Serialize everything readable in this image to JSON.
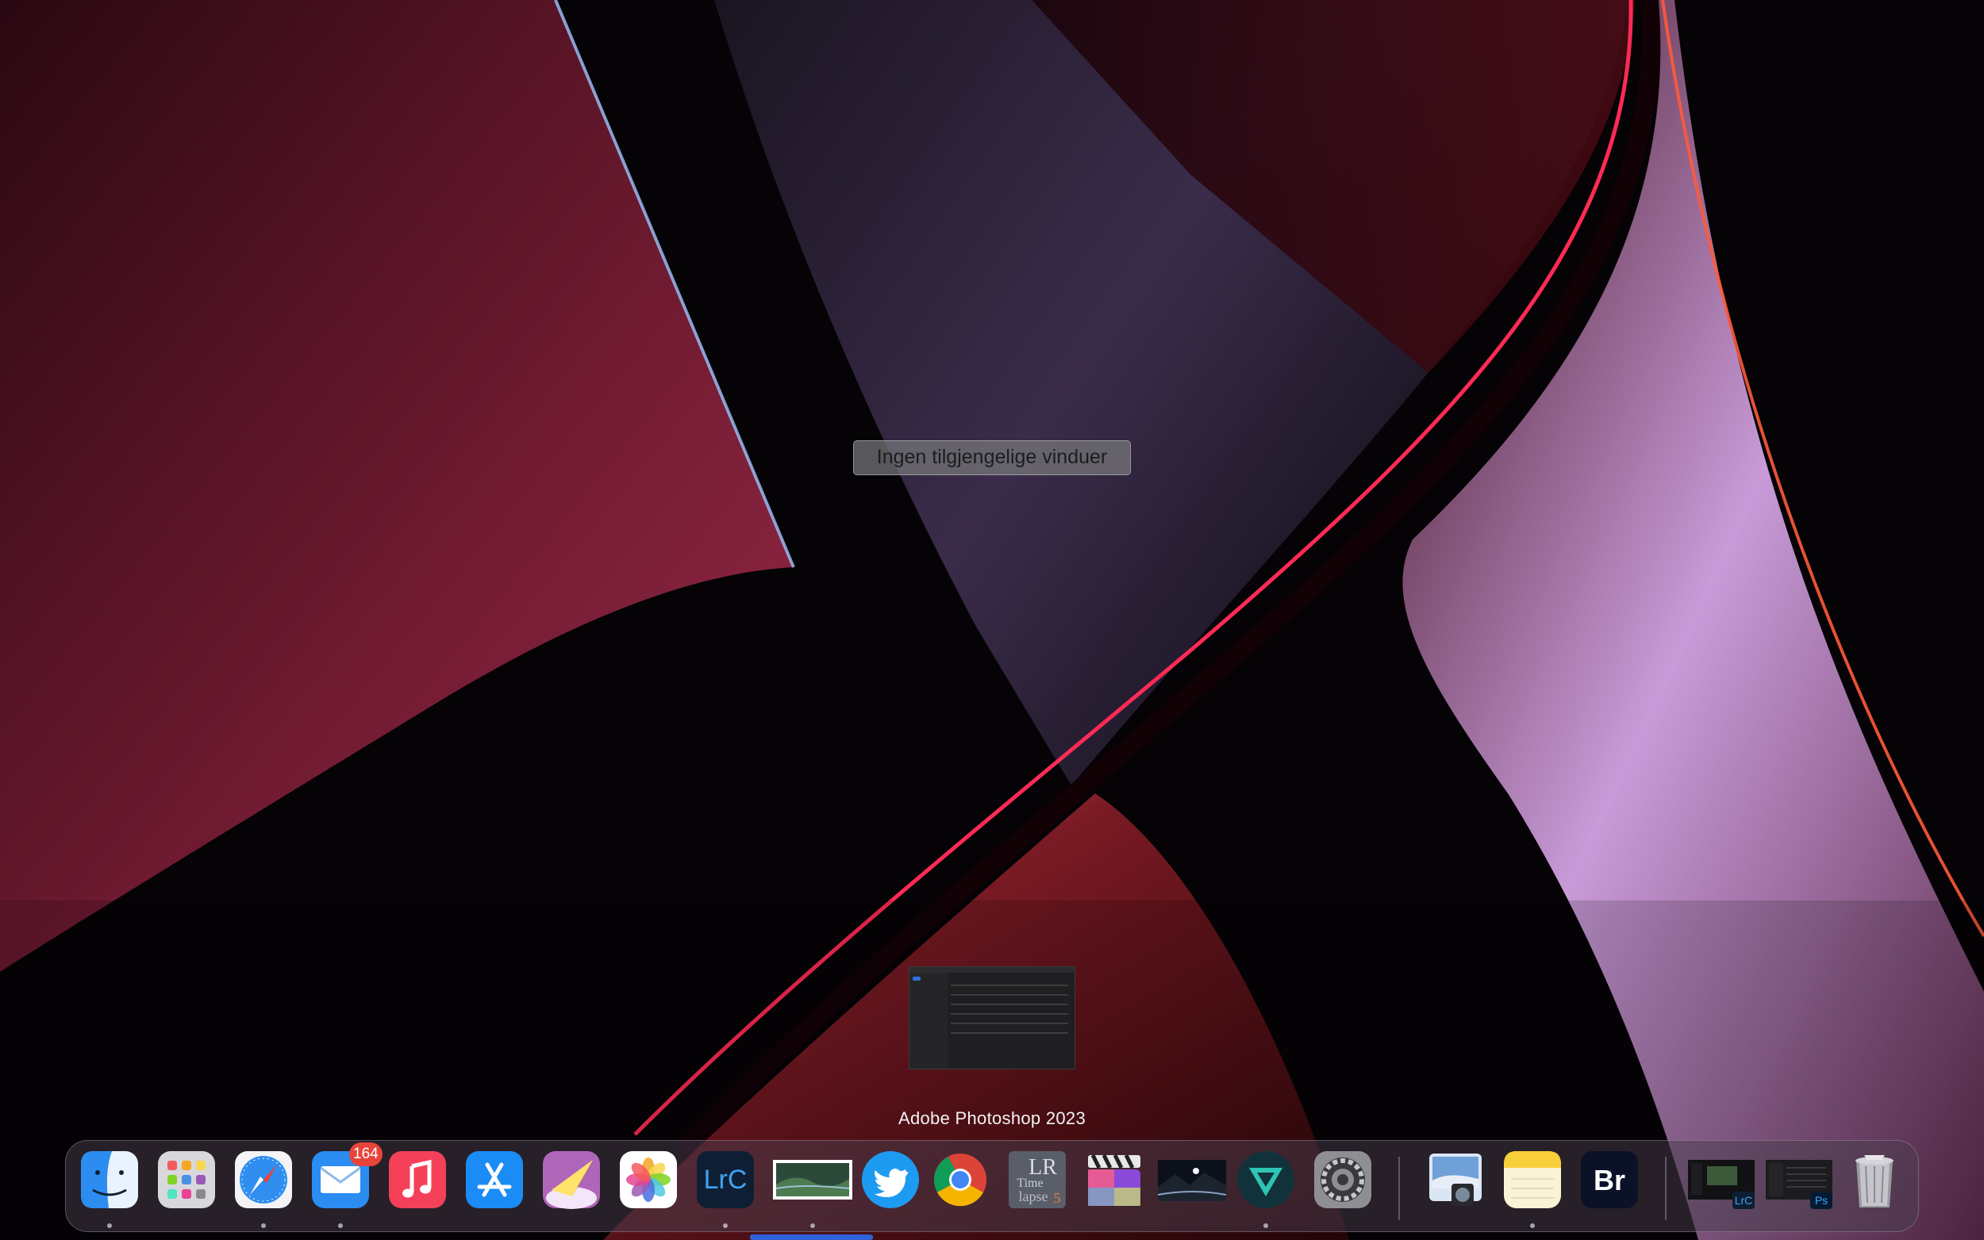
{
  "mission_control": {
    "empty_message": "Ingen tilgjengelige vinduer",
    "active_app_name": "Adobe Photoshop 2023"
  },
  "dock": {
    "apps": [
      {
        "name": "Finder",
        "icon": "finder-icon",
        "running": true
      },
      {
        "name": "Launchpad",
        "icon": "launchpad-icon",
        "running": false
      },
      {
        "name": "Safari",
        "icon": "safari-icon",
        "running": true
      },
      {
        "name": "Mail",
        "icon": "mail-icon",
        "running": true,
        "badge": "164"
      },
      {
        "name": "Music",
        "icon": "music-icon",
        "running": false
      },
      {
        "name": "App Store",
        "icon": "app-store-icon",
        "running": false
      },
      {
        "name": "Messenger",
        "icon": "paper-plane-icon",
        "running": false
      },
      {
        "name": "Photos",
        "icon": "photos-icon",
        "running": false
      },
      {
        "name": "Lightroom Classic",
        "icon": "lrc-icon",
        "icon_text": "LrC",
        "running": true
      },
      {
        "name": "Photoshop",
        "icon": "photoshop-landscape-icon",
        "running": true
      },
      {
        "name": "Twitter",
        "icon": "twitter-bird-icon",
        "running": false
      },
      {
        "name": "Google Chrome",
        "icon": "chrome-icon",
        "running": false
      },
      {
        "name": "LRTimelapse",
        "icon": "lrtimelapse-icon",
        "icon_text_top": "LR",
        "icon_text_mid": "Time",
        "icon_text_bottom": "lapse",
        "icon_text_num": "5",
        "running": false
      },
      {
        "name": "Final Cut Pro",
        "icon": "clapperboard-icon",
        "running": false
      },
      {
        "name": "Night Photo",
        "icon": "night-landscape-icon",
        "running": false
      },
      {
        "name": "Vue",
        "icon": "v-logo-icon",
        "running": true
      },
      {
        "name": "System Settings",
        "icon": "gear-icon",
        "running": false
      },
      {
        "name": "Preview",
        "icon": "preview-icon",
        "running": false
      },
      {
        "name": "Notes",
        "icon": "notes-icon",
        "running": true
      },
      {
        "name": "Adobe Bridge",
        "icon": "bridge-icon",
        "icon_text": "Br",
        "running": false
      }
    ],
    "minimized": [
      {
        "name": "Lightroom window",
        "icon": "lrc-window-icon",
        "icon_text": "LrC"
      },
      {
        "name": "Photoshop window",
        "icon": "ps-window-icon",
        "icon_text": "Ps"
      }
    ],
    "trash": {
      "name": "Trash",
      "icon": "trash-icon"
    }
  },
  "colors": {
    "wallpaper_red": "#8c1e3c",
    "wallpaper_violet": "#9a86c8",
    "wallpaper_rim": "#ff2a55",
    "badge": "#e8443a",
    "drag_indicator": "#2d62d8"
  }
}
